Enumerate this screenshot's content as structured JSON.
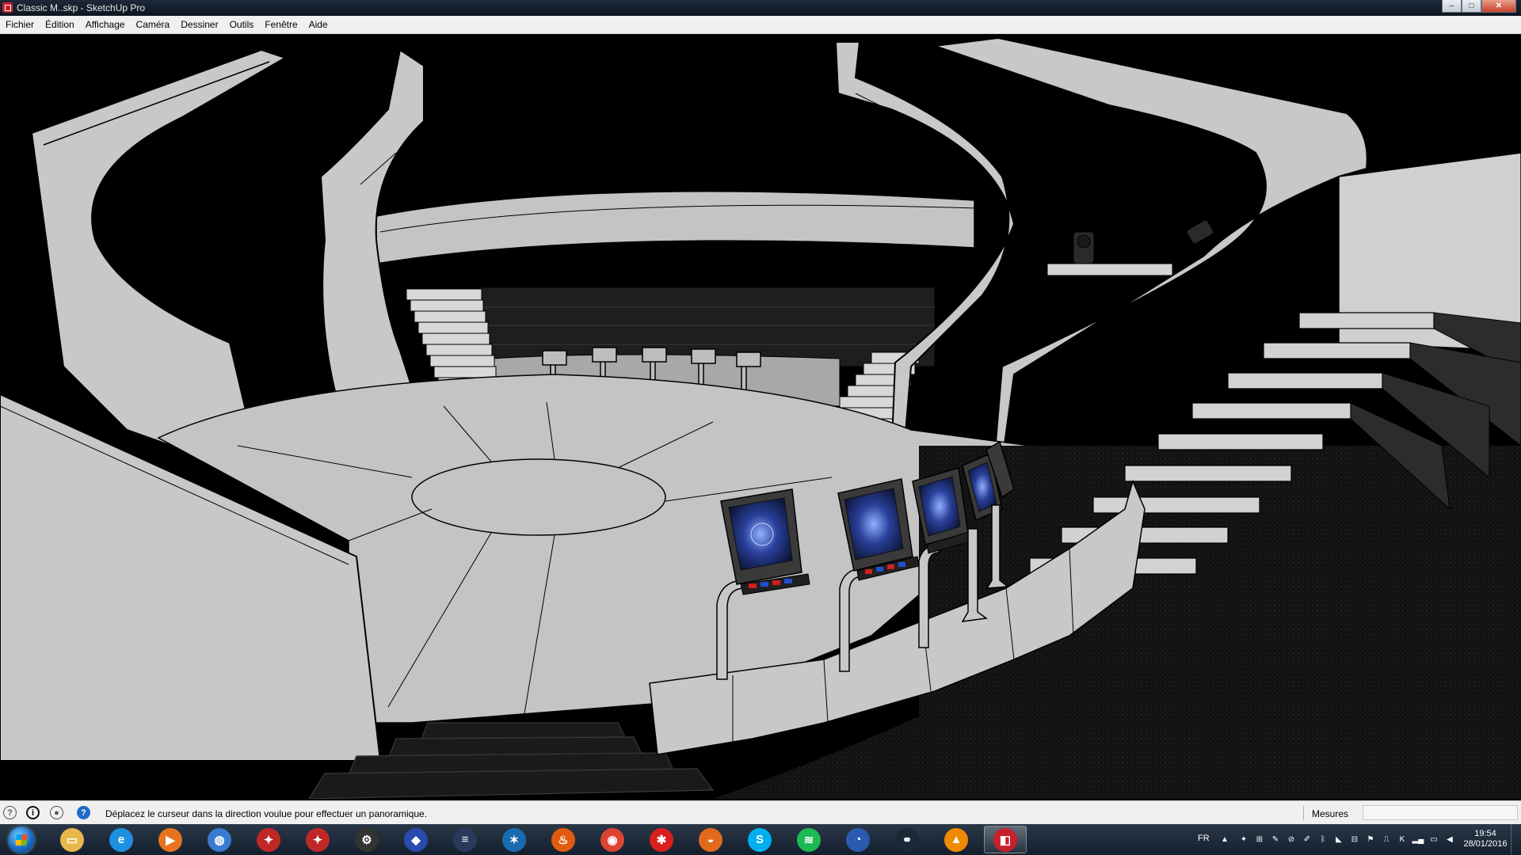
{
  "window": {
    "title": "Classic M..skp - SketchUp Pro",
    "controls": {
      "minimize": "–",
      "maximize": "□",
      "close": "✕"
    }
  },
  "menu": [
    "Fichier",
    "Édition",
    "Affichage",
    "Caméra",
    "Dessiner",
    "Outils",
    "Fenêtre",
    "Aide"
  ],
  "viewport": {
    "scene": "3D model of a circular game-show studio with a central disc stage, curved staircases, stands with screens, and tiered seating",
    "colors": {
      "background": "#000000",
      "surface": "#c8c8c8",
      "dark_surface": "#2a2a2a",
      "edge": "#000000"
    }
  },
  "statusbar": {
    "icons": [
      "geo-location-icon",
      "credits-icon",
      "user-account-icon",
      "help-icon"
    ],
    "status_text": "Déplacez le curseur dans la direction voulue pour effectuer un panoramique.",
    "measure_label": "Mesures",
    "measure_value": ""
  },
  "taskbar": {
    "apps": [
      {
        "name": "explorer-icon",
        "color": "#e8b84a",
        "glyph": "▭",
        "active": false
      },
      {
        "name": "internet-explorer-icon",
        "color": "#1e90e0",
        "glyph": "e",
        "active": false
      },
      {
        "name": "media-player-icon",
        "color": "#e8731e",
        "glyph": "▶",
        "active": false
      },
      {
        "name": "globe-app-icon",
        "color": "#3a7ad0",
        "glyph": "◍",
        "active": false
      },
      {
        "name": "dragon-app-icon",
        "color": "#c02828",
        "glyph": "✦",
        "active": false
      },
      {
        "name": "dragon-app-2-icon",
        "color": "#c02828",
        "glyph": "✦",
        "active": false
      },
      {
        "name": "steelseries-icon",
        "color": "#333333",
        "glyph": "⚙",
        "active": false
      },
      {
        "name": "game-launcher-icon",
        "color": "#2a4ab0",
        "glyph": "◆",
        "active": false
      },
      {
        "name": "notes-app-icon",
        "color": "#2a3a5a",
        "glyph": "≡",
        "active": false
      },
      {
        "name": "battlenet-icon",
        "color": "#1a6ab0",
        "glyph": "✶",
        "active": false
      },
      {
        "name": "fire-app-icon",
        "color": "#e05a10",
        "glyph": "♨",
        "active": false
      },
      {
        "name": "chrome-icon",
        "color": "#dd4433",
        "glyph": "◉",
        "active": false
      },
      {
        "name": "uplay-red-icon",
        "color": "#d81e1e",
        "glyph": "✱",
        "active": false
      },
      {
        "name": "firefox-icon",
        "color": "#e06a1a",
        "glyph": "◒",
        "active": false
      },
      {
        "name": "skype-icon",
        "color": "#00aff0",
        "glyph": "S",
        "active": false
      },
      {
        "name": "spotify-icon",
        "color": "#1db954",
        "glyph": "≋",
        "active": false
      },
      {
        "name": "origin-icon",
        "color": "#2a5ab0",
        "glyph": "◔",
        "active": false
      },
      {
        "name": "steam-icon",
        "color": "#1b2838",
        "glyph": "⚭",
        "active": false
      },
      {
        "name": "vlc-icon",
        "color": "#f08a00",
        "glyph": "▲",
        "active": false
      },
      {
        "name": "sketchup-icon",
        "color": "#c8202a",
        "glyph": "◧",
        "active": true
      }
    ],
    "tray": {
      "language": "FR",
      "time": "19:54",
      "date": "28/01/2016"
    }
  }
}
